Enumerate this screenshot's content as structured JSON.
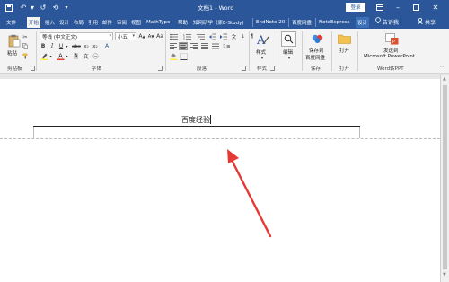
{
  "titlebar": {
    "doc_title": "文档1 - Word",
    "sign_in": "登录"
  },
  "tabs": [
    {
      "label": "文件"
    },
    {
      "label": "开始"
    },
    {
      "label": "插入"
    },
    {
      "label": "设计"
    },
    {
      "label": "布局"
    },
    {
      "label": "引用"
    },
    {
      "label": "邮件"
    },
    {
      "label": "审阅"
    },
    {
      "label": "视图"
    },
    {
      "label": "MathType"
    },
    {
      "label": "帮助"
    },
    {
      "label": "知网研学（原E-Study)"
    },
    {
      "label": "EndNote 20"
    },
    {
      "label": "百度网盘"
    },
    {
      "label": "NoteExpress"
    },
    {
      "label": "设计"
    }
  ],
  "tell_me": "告诉我",
  "share": "共享",
  "ribbon": {
    "clipboard": {
      "paste": "粘贴",
      "label": "剪贴板"
    },
    "font": {
      "family": "等线 (中文正文)",
      "size": "小五",
      "label": "字体"
    },
    "paragraph": {
      "label": "段落"
    },
    "styles": {
      "big": "样式",
      "label": "样式"
    },
    "editing": {
      "big": "编辑"
    },
    "save": {
      "big1": "保存到",
      "big2": "百度网盘",
      "label": "保存"
    },
    "open": {
      "big": "打开",
      "label": "打开"
    },
    "send": {
      "big1": "发送到",
      "big2": "Microsoft PowerPoint",
      "label": "Word转PPT"
    }
  },
  "document": {
    "header_text": "百度经验"
  },
  "colors": {
    "brand": "#2b579a",
    "arrow": "#e53935"
  }
}
